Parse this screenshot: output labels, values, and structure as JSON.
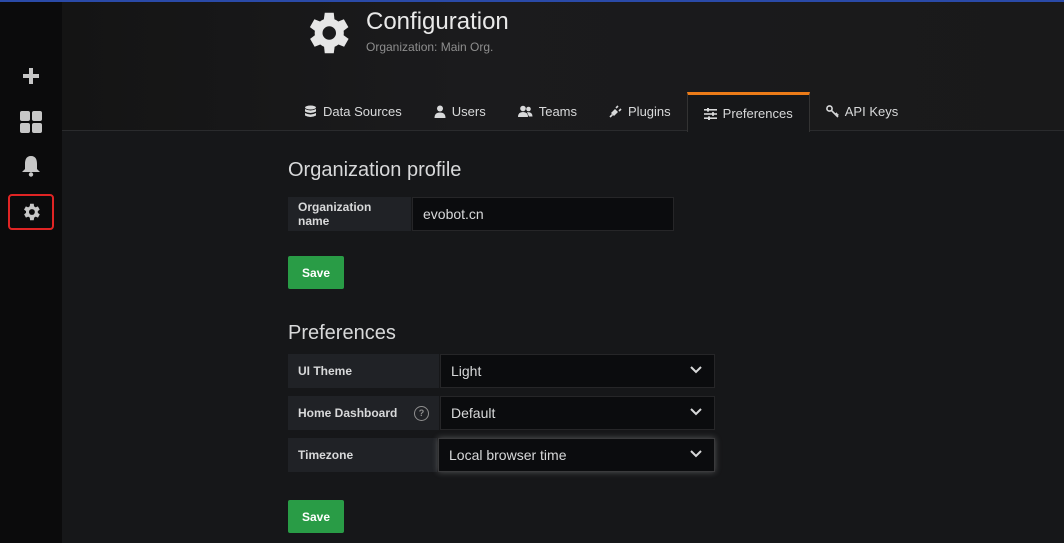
{
  "header": {
    "title": "Configuration",
    "subtitle": "Organization: Main Org."
  },
  "sidebar": {
    "items": [
      {
        "name": "plus-icon"
      },
      {
        "name": "dashboards-icon"
      },
      {
        "name": "bell-icon"
      },
      {
        "name": "gear-icon",
        "highlighted": true
      }
    ]
  },
  "tabs": [
    {
      "label": "Data Sources",
      "icon": "database-icon"
    },
    {
      "label": "Users",
      "icon": "user-icon"
    },
    {
      "label": "Teams",
      "icon": "users-icon"
    },
    {
      "label": "Plugins",
      "icon": "plug-icon"
    },
    {
      "label": "Preferences",
      "icon": "sliders-icon",
      "active": true
    },
    {
      "label": "API Keys",
      "icon": "key-icon"
    }
  ],
  "org_profile": {
    "title": "Organization profile",
    "name_label": "Organization name",
    "name_value": "evobot.cn",
    "save_label": "Save"
  },
  "preferences": {
    "title": "Preferences",
    "ui_theme_label": "UI Theme",
    "ui_theme_value": "Light",
    "home_dashboard_label": "Home Dashboard",
    "home_dashboard_help": "?",
    "home_dashboard_value": "Default",
    "timezone_label": "Timezone",
    "timezone_value": "Local browser time",
    "save_label": "Save"
  },
  "colors": {
    "accent": "#eb7b18",
    "save_button": "#299c46",
    "highlight_border": "#e02424"
  }
}
